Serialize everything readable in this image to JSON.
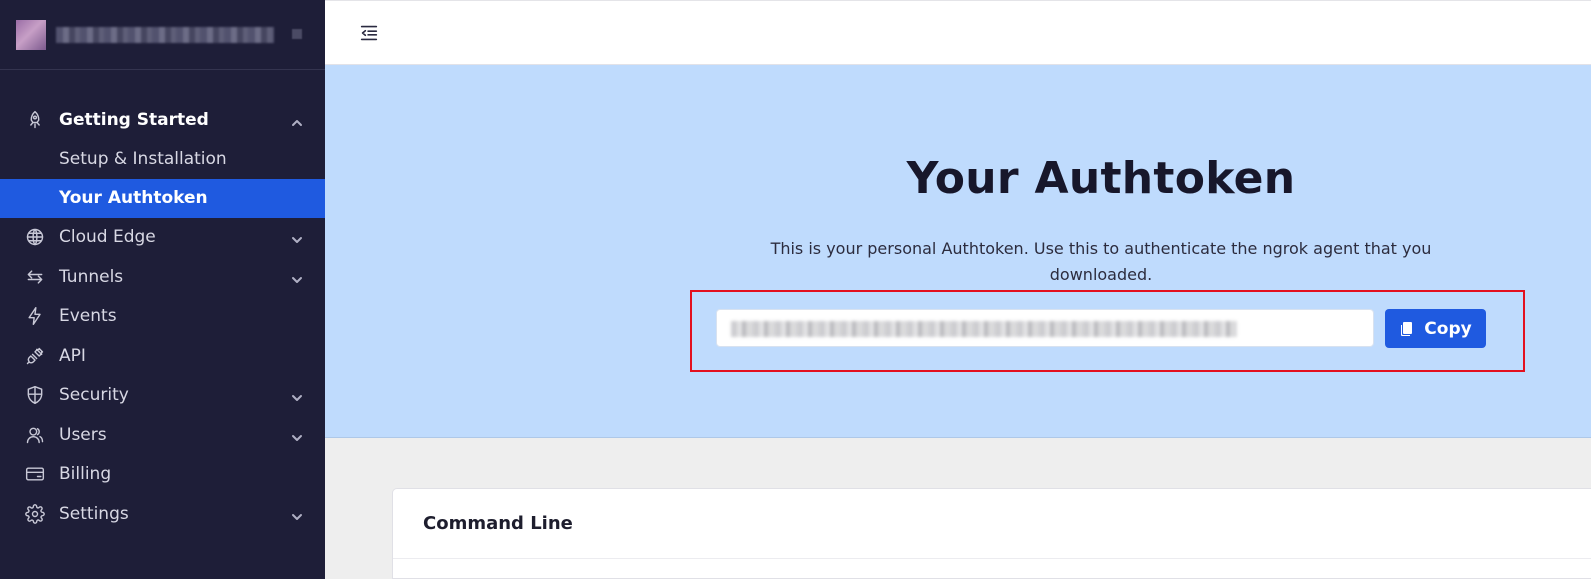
{
  "sidebar": {
    "brand": {
      "logo_icon": "account-avatar",
      "name_redacted": true
    },
    "sections": [
      {
        "label": "Getting Started",
        "icon": "rocket-icon",
        "expanded": true,
        "children": [
          {
            "label": "Setup & Installation",
            "active": false
          },
          {
            "label": "Your Authtoken",
            "active": true
          }
        ]
      },
      {
        "label": "Cloud Edge",
        "icon": "globe-icon",
        "expandable": true
      },
      {
        "label": "Tunnels",
        "icon": "arrows-icon",
        "expandable": true
      },
      {
        "label": "Events",
        "icon": "bolt-icon",
        "expandable": false
      },
      {
        "label": "API",
        "icon": "plug-icon",
        "expandable": false
      },
      {
        "label": "Security",
        "icon": "shield-icon",
        "expandable": true
      },
      {
        "label": "Users",
        "icon": "users-icon",
        "expandable": true
      },
      {
        "label": "Billing",
        "icon": "credit-card-icon",
        "expandable": false
      },
      {
        "label": "Settings",
        "icon": "gear-icon",
        "expandable": true
      }
    ]
  },
  "topbar": {
    "collapse_icon": "collapse-sidebar-icon"
  },
  "hero": {
    "title": "Your Authtoken",
    "description": "This is your personal Authtoken. Use this to authenticate the ngrok agent that you downloaded.",
    "token_redacted": true,
    "copy_label": "Copy"
  },
  "command_line": {
    "title": "Command Line"
  },
  "colors": {
    "sidebar_bg": "#1e1e38",
    "active_item": "#1f5ae0",
    "hero_bg": "#bfdbfd",
    "highlight_border": "#e3101e"
  }
}
